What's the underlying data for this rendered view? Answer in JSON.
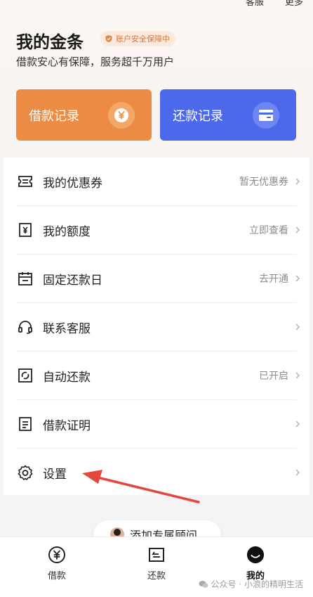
{
  "top_links": [
    "客服",
    "更多"
  ],
  "header": {
    "title": "我的金条",
    "badge": "账户安全保障中",
    "subtitle": "借款安心有保障，服务超千万用户"
  },
  "cards": [
    {
      "label": "借款记录",
      "icon": "yuan-icon"
    },
    {
      "label": "还款记录",
      "icon": "card-icon"
    }
  ],
  "menu": [
    {
      "label": "我的优惠券",
      "value": "暂无优惠券",
      "icon": "ticket-icon"
    },
    {
      "label": "我的额度",
      "value": "立即查看",
      "icon": "quota-icon"
    },
    {
      "label": "固定还款日",
      "value": "去开通",
      "icon": "calendar-icon"
    },
    {
      "label": "联系客服",
      "value": "",
      "icon": "headset-icon"
    },
    {
      "label": "自动还款",
      "value": "已开启",
      "icon": "auto-repay-icon"
    },
    {
      "label": "借款证明",
      "value": "",
      "icon": "document-icon"
    },
    {
      "label": "设置",
      "value": "",
      "icon": "gear-icon"
    }
  ],
  "floating": {
    "label": "添加专属顾问"
  },
  "tabs": [
    {
      "label": "借款",
      "icon": "yuan-icon"
    },
    {
      "label": "还款",
      "icon": "repay-icon"
    },
    {
      "label": "我的",
      "icon": "smile-icon",
      "active": true
    }
  ],
  "watermark": "公众号 · 小浪的精明生活",
  "colors": {
    "orange": "#ec8c44",
    "blue": "#4c69ec",
    "arrow": "#e4483d"
  }
}
